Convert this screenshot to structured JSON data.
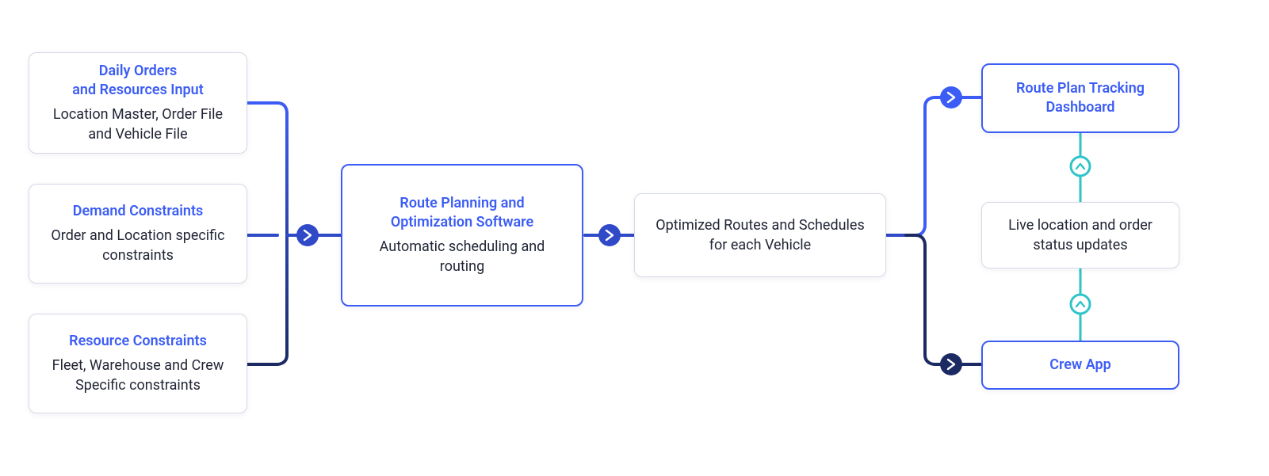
{
  "nodes": {
    "inputA": {
      "title": "Daily Orders\nand Resources Input",
      "body": "Location Master, Order File and Vehicle File"
    },
    "inputB": {
      "title": "Demand Constraints",
      "body": "Order and Location specific constraints"
    },
    "inputC": {
      "title": "Resource Constraints",
      "body": "Fleet, Warehouse and Crew Specific constraints"
    },
    "center": {
      "title": "Route Planning and Optimization Software",
      "body": "Automatic scheduling and routing"
    },
    "optimized": {
      "body": "Optimized Routes and Schedules for each Vehicle"
    },
    "dashboard": {
      "title": "Route Plan Tracking Dashboard"
    },
    "live": {
      "body": "Live location and order status updates"
    },
    "crew": {
      "title": "Crew App"
    }
  },
  "colors": {
    "accent": "#3c5df5",
    "dark": "#1b2a63",
    "teal": "#2fc4c8",
    "cardBorder": "#d5d9e6"
  }
}
